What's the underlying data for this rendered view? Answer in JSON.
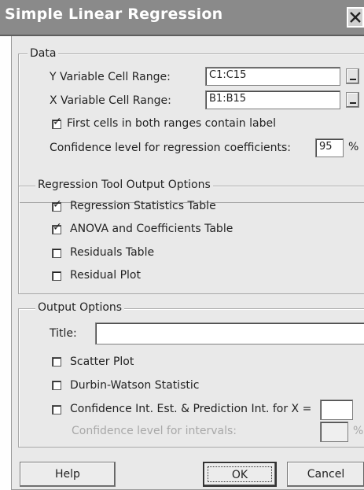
{
  "window": {
    "title": "Simple Linear Regression",
    "close_icon": "close-icon"
  },
  "data_group": {
    "legend": "Data",
    "y_label": "Y Variable Cell Range:",
    "y_value": "C1:C15",
    "x_label": "X Variable Cell Range:",
    "x_value": "B1:B15",
    "labels_checkbox": {
      "label": "First cells in both ranges contain label",
      "checked": true
    },
    "confidence_label": "Confidence level for regression coefficients:",
    "confidence_value": "95",
    "confidence_unit": "%"
  },
  "regression_group": {
    "legend": "Regression Tool Output Options",
    "options": [
      {
        "label": "Regression Statistics Table",
        "checked": true
      },
      {
        "label": "ANOVA and Coefficients Table",
        "checked": true
      },
      {
        "label": "Residuals Table",
        "checked": false
      },
      {
        "label": "Residual Plot",
        "checked": false
      }
    ]
  },
  "output_group": {
    "legend": "Output Options",
    "title_label": "Title:",
    "title_value": "",
    "options": [
      {
        "label": "Scatter Plot",
        "checked": false
      },
      {
        "label": "Durbin-Watson Statistic",
        "checked": false
      },
      {
        "label": "Confidence Int. Est. & Prediction Int. for X =",
        "checked": false
      }
    ],
    "x_value": "",
    "interval_label": "Confidence level for intervals:",
    "interval_value": "",
    "interval_unit": "%"
  },
  "buttons": {
    "help": "Help",
    "ok": "OK",
    "cancel": "Cancel"
  },
  "check_mark": "✓"
}
